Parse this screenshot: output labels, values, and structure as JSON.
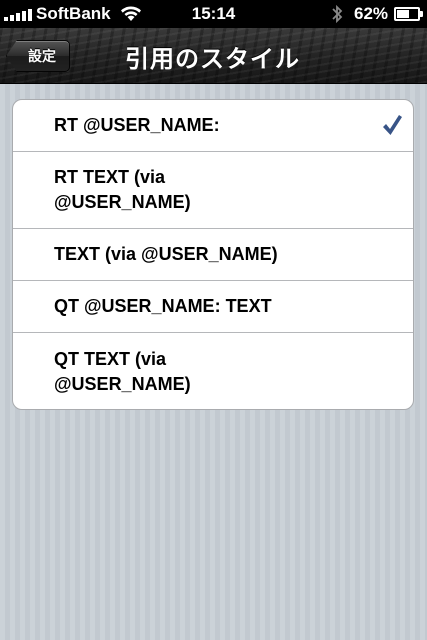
{
  "status_bar": {
    "carrier": "SoftBank",
    "time": "15:14",
    "battery_percent": "62%",
    "battery_level": 0.62
  },
  "nav_bar": {
    "back_label": "設定",
    "title": "引用のスタイル"
  },
  "quote_styles": [
    {
      "label": "RT @USER_NAME:",
      "selected": true
    },
    {
      "label": "RT TEXT (via\n@USER_NAME)",
      "selected": false
    },
    {
      "label": "TEXT (via @USER_NAME)",
      "selected": false
    },
    {
      "label": "QT @USER_NAME: TEXT",
      "selected": false
    },
    {
      "label": "QT TEXT (via\n@USER_NAME)",
      "selected": false
    }
  ],
  "colors": {
    "checkmark": "#385487",
    "background": "#c5ccd4"
  },
  "icons": {
    "signal": "signal-bars-icon",
    "wifi": "wifi-icon",
    "bluetooth": "bluetooth-icon",
    "battery": "battery-icon",
    "check": "checkmark-icon"
  }
}
